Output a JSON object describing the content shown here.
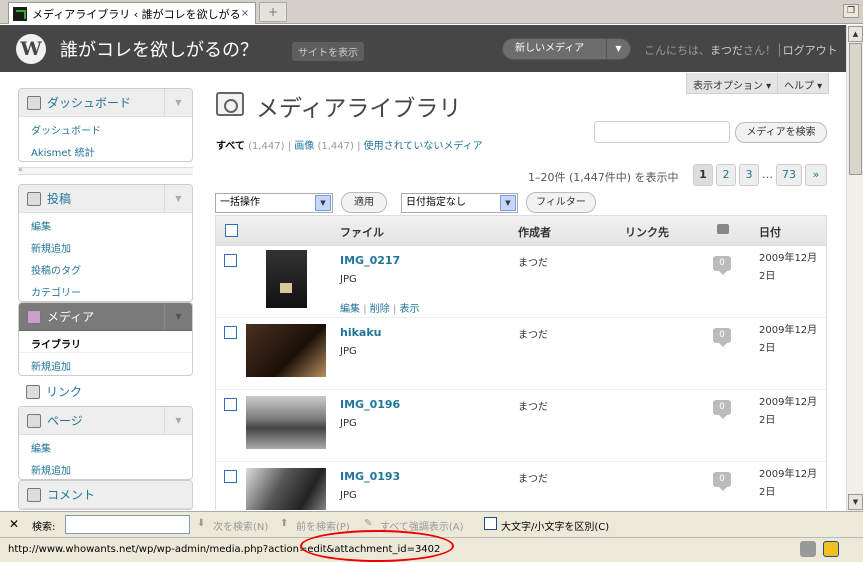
{
  "browser": {
    "tab_title": "メディアライブラリ ‹ 誰がコレを欲しがる...",
    "tab_close": "×",
    "new_tab": "+",
    "status_url": "http://www.whowants.net/wp/wp-admin/media.php?action=edit&attachment_id=3402"
  },
  "adminbar": {
    "site_title": "誰がコレを欲しがるの？",
    "view_site": "サイトを表示",
    "favorite_action": "新しいメディア",
    "howdy": "こんにちは、",
    "user": "まつだ",
    "howdy_suffix": "さん！",
    "logout": "ログアウト"
  },
  "screen_options": "表示オプション ▾",
  "help": "ヘルプ ▾",
  "menu": {
    "dashboard": {
      "label": "ダッシュボード",
      "items": [
        "ダッシュボード",
        "Akismet 統計"
      ]
    },
    "posts": {
      "label": "投稿",
      "items": [
        "編集",
        "新規追加",
        "投稿のタグ",
        "カテゴリー"
      ]
    },
    "media": {
      "label": "メディア",
      "items": [
        "ライブラリ",
        "新規追加"
      ]
    },
    "links": {
      "label": "リンク"
    },
    "pages": {
      "label": "ページ",
      "items": [
        "編集",
        "新規追加"
      ]
    },
    "comments": {
      "label": "コメント"
    }
  },
  "page": {
    "title": "メディアライブラリ",
    "filters": {
      "all": "すべて",
      "all_count": "(1,447)",
      "sep1": "|",
      "images": "画像",
      "images_count": "(1,447)",
      "sep2": "|",
      "unattached": "使用されていないメディア"
    },
    "search_button": "メディアを検索",
    "displaying": "1–20件 (1,447件中) を表示中",
    "pagination": [
      "1",
      "2",
      "3",
      "73",
      "»"
    ],
    "pagination_dots": "…",
    "bulk_action": "一括操作",
    "apply": "適用",
    "date_filter": "日付指定なし",
    "filter": "フィルター"
  },
  "table": {
    "columns": {
      "file": "ファイル",
      "author": "作成者",
      "parent": "リンク先",
      "date": "日付"
    },
    "rows": [
      {
        "name": "IMG_0217",
        "type": "JPG",
        "author": "まつだ",
        "comments": "0",
        "date1": "2009年12月",
        "date2": "2日",
        "actions": {
          "edit": "編集",
          "delete": "削除",
          "view": "表示",
          "sep": "|"
        }
      },
      {
        "name": "hikaku",
        "type": "JPG",
        "author": "まつだ",
        "comments": "0",
        "date1": "2009年12月",
        "date2": "2日"
      },
      {
        "name": "IMG_0196",
        "type": "JPG",
        "author": "まつだ",
        "comments": "0",
        "date1": "2009年12月",
        "date2": "2日"
      },
      {
        "name": "IMG_0193",
        "type": "JPG",
        "author": "まつだ",
        "comments": "0",
        "date1": "2009年12月",
        "date2": "2日"
      }
    ]
  },
  "findbar": {
    "close": "✕",
    "label": "検索:",
    "next": "次を検索(N)",
    "prev": "前を検索(P)",
    "highlight": "すべて強調表示(A)",
    "match_case": "大文字/小文字を区別(C)"
  },
  "colors": {
    "adminbar": "#464646",
    "link": "#21759b",
    "annotation": "#ee0000"
  }
}
